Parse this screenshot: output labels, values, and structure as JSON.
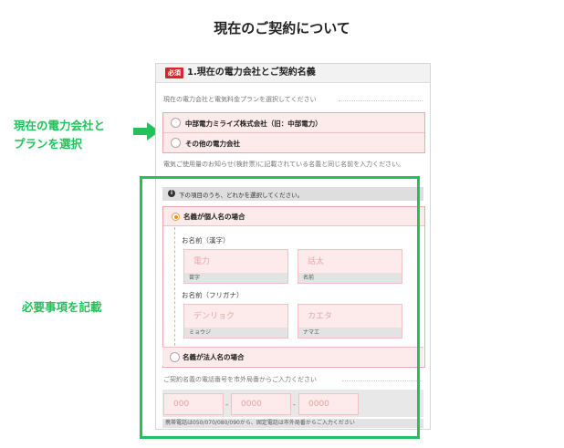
{
  "page_title": "現在のご契約について",
  "section": {
    "required_badge": "必須",
    "title": "1.現在の電力会社とご契約名義"
  },
  "company_question": "現在の電力会社と電気料金プランを選択してください",
  "company_options": [
    "中部電力ミライズ株式会社（旧：中部電力）",
    "その他の電力会社"
  ],
  "name_question": "電気ご使用量のお知らせ(検針票)に記載されている名義と同じ名前を入力ください。",
  "note": "下の項目のうち、どれかを選択してください。",
  "individual": {
    "label": "名義が個人名の場合",
    "kanji_label": "お名前（漢字）",
    "kanji_fields": [
      {
        "placeholder": "電力",
        "caption": "苗字"
      },
      {
        "placeholder": "話太",
        "caption": "名前"
      }
    ],
    "kana_label": "お名前（フリガナ）",
    "kana_fields": [
      {
        "placeholder": "デンリョク",
        "caption": "ミョウジ"
      },
      {
        "placeholder": "カエタ",
        "caption": "ナマエ"
      }
    ]
  },
  "corporate": {
    "label": "名義が法人名の場合"
  },
  "phone": {
    "question": "ご契約名義の電話番号を市外局番からご入力ください",
    "placeholders": [
      "000",
      "0000",
      "0000"
    ],
    "separator": "-",
    "note": "携帯電話は050/070/080/090から、固定電話は市外局番からご入力ください"
  },
  "callouts": {
    "company_select": [
      "現在の電力会社と",
      "プランを選択"
    ],
    "required_fill": "必要事項を記載"
  },
  "colors": {
    "accent_green": "#22c25a",
    "badge_red": "#d9262c",
    "field_pink": "#fdeaea",
    "radio_orange": "#f28c28"
  },
  "icons": {
    "info": "info-icon",
    "arrow": "arrow-right-icon"
  }
}
